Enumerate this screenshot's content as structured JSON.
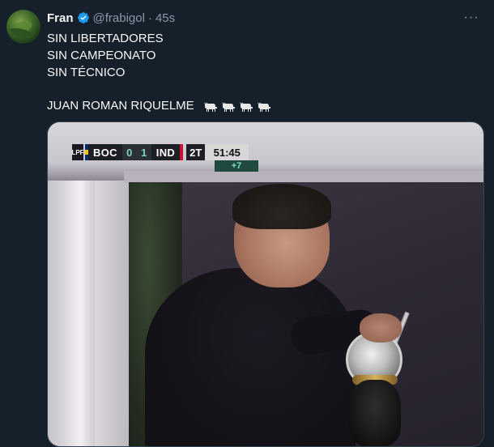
{
  "tweet": {
    "author_name": "Fran",
    "handle": "@frabigol",
    "separator": "·",
    "time": "45s",
    "more_label": "···",
    "lines": [
      "SIN LIBERTADORES",
      "SIN CAMPEONATO",
      "SIN TÉCNICO"
    ],
    "final_line": "JUAN ROMAN RIQUELME",
    "emoji_count": 4,
    "emoji_name": "goat-emoji"
  },
  "scoreboard": {
    "league_badge": "LPF",
    "home_team": "BOC",
    "home_score": "0",
    "away_score": "1",
    "away_team": "IND",
    "period": "2T",
    "clock": "51:45",
    "added_time": "+7",
    "colors": {
      "home": "#0a2a73",
      "home_secondary": "#f2c200",
      "away": "#c8102e",
      "score_text": "#7ad3c3",
      "added_bg": "#1f4a3f"
    }
  },
  "theme": {
    "background": "#15202b",
    "text": "#f7f9f9",
    "secondary_text": "#8b98a5",
    "verified": "#1d9bf0",
    "border": "#38444d"
  }
}
